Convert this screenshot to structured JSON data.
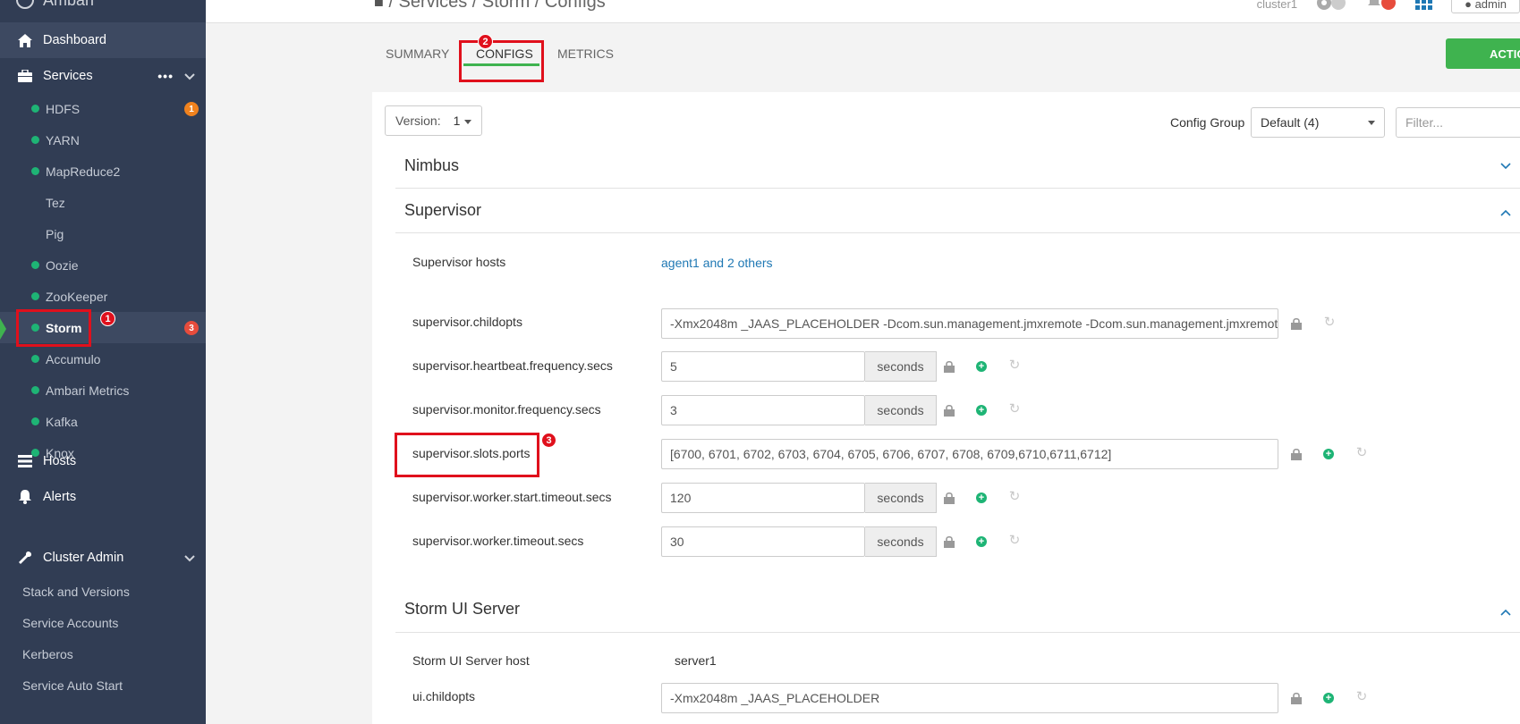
{
  "sidebar": {
    "brand": "Ambari",
    "dashboard": "Dashboard",
    "services_label": "Services",
    "services": [
      {
        "label": "HDFS",
        "dot": true,
        "badge": "1",
        "badge_color": "#f0821e"
      },
      {
        "label": "YARN",
        "dot": true
      },
      {
        "label": "MapReduce2",
        "dot": true
      },
      {
        "label": "Tez",
        "dot": false
      },
      {
        "label": "Pig",
        "dot": false
      },
      {
        "label": "Oozie",
        "dot": true
      },
      {
        "label": "ZooKeeper",
        "dot": true
      },
      {
        "label": "Storm",
        "dot": true,
        "badge": "3",
        "badge_color": "#e74c3c",
        "active": true
      },
      {
        "label": "Accumulo",
        "dot": true
      },
      {
        "label": "Ambari Metrics",
        "dot": true
      },
      {
        "label": "Kafka",
        "dot": true
      },
      {
        "label": "Knox",
        "dot": true
      }
    ],
    "hosts": "Hosts",
    "alerts": "Alerts",
    "cluster_admin": "Cluster Admin",
    "admin_items": [
      "Stack and Versions",
      "Service Accounts",
      "Kerberos",
      "Service Auto Start"
    ]
  },
  "topbar": {
    "breadcrumb": "/ Services / Storm / Configs",
    "cluster": "cluster1",
    "user": "admin"
  },
  "annotations": {
    "one": "1",
    "two": "2",
    "three": "3"
  },
  "tabs": {
    "summary": "SUMMARY",
    "configs": "CONFIGS",
    "metrics": "METRICS"
  },
  "actions_label": "ACTIONS",
  "toolbar": {
    "version_label": "Version:",
    "version_value": "1",
    "config_group_label": "Config Group",
    "config_group_value": "Default (4)",
    "filter_placeholder": "Filter..."
  },
  "sections": {
    "nimbus": "Nimbus",
    "supervisor": "Supervisor",
    "ui_server": "Storm UI Server"
  },
  "supervisor": {
    "hosts_label": "Supervisor hosts",
    "hosts_value": "agent1 and 2 others",
    "childopts_label": "supervisor.childopts",
    "childopts_value": "-Xmx2048m _JAAS_PLACEHOLDER -Dcom.sun.management.jmxremote -Dcom.sun.management.jmxremote.ssl=false",
    "heartbeat_label": "supervisor.heartbeat.frequency.secs",
    "heartbeat_value": "5",
    "monitor_label": "supervisor.monitor.frequency.secs",
    "monitor_value": "3",
    "slots_label": "supervisor.slots.ports",
    "slots_value": "[6700, 6701, 6702, 6703, 6704, 6705, 6706, 6707, 6708, 6709,6710,6711,6712]",
    "worker_start_label": "supervisor.worker.start.timeout.secs",
    "worker_start_value": "120",
    "worker_timeout_label": "supervisor.worker.timeout.secs",
    "worker_timeout_value": "30",
    "unit": "seconds"
  },
  "ui_server": {
    "host_label": "Storm UI Server host",
    "host_value": "server1",
    "childopts_label": "ui.childopts",
    "childopts_value": "-Xmx2048m _JAAS_PLACEHOLDER"
  }
}
